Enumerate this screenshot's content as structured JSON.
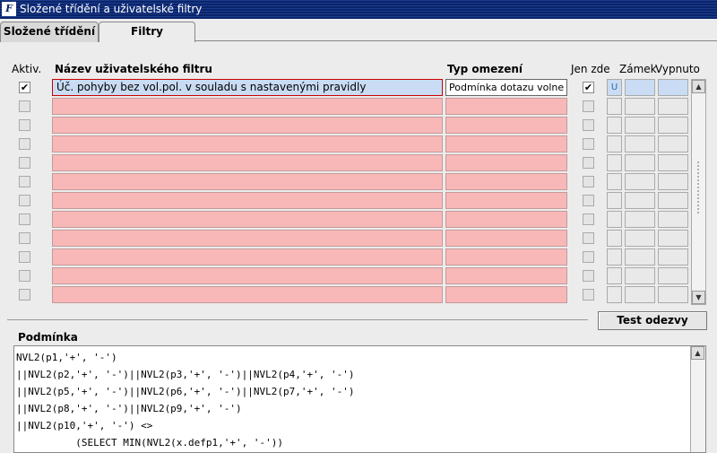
{
  "window": {
    "title": "Složené třídění a uživatelské filtry",
    "icon": "forms-icon"
  },
  "tabs": [
    {
      "label": "Složené třídění"
    },
    {
      "label": "Filtry"
    }
  ],
  "columns": {
    "aktiv": "Aktiv.",
    "name": "Název uživatelského filtru",
    "typ": "Typ omezení",
    "jen_zde": "Jen zde",
    "zamek": "Zámek",
    "vypnuto": "Vypnuto"
  },
  "rows": [
    {
      "aktiv": "✔",
      "name": "Úč. pohyby bez vol.pol. v souladu s nastavenými pravidly",
      "typ": "Podmínka dotazu volne",
      "jen_zde": "✔",
      "zamek": "U"
    },
    {
      "aktiv": "",
      "name": "",
      "typ": "",
      "jen_zde": "",
      "zamek": ""
    },
    {
      "aktiv": "",
      "name": "",
      "typ": "",
      "jen_zde": "",
      "zamek": ""
    },
    {
      "aktiv": "",
      "name": "",
      "typ": "",
      "jen_zde": "",
      "zamek": ""
    },
    {
      "aktiv": "",
      "name": "",
      "typ": "",
      "jen_zde": "",
      "zamek": ""
    },
    {
      "aktiv": "",
      "name": "",
      "typ": "",
      "jen_zde": "",
      "zamek": ""
    },
    {
      "aktiv": "",
      "name": "",
      "typ": "",
      "jen_zde": "",
      "zamek": ""
    },
    {
      "aktiv": "",
      "name": "",
      "typ": "",
      "jen_zde": "",
      "zamek": ""
    },
    {
      "aktiv": "",
      "name": "",
      "typ": "",
      "jen_zde": "",
      "zamek": ""
    },
    {
      "aktiv": "",
      "name": "",
      "typ": "",
      "jen_zde": "",
      "zamek": ""
    },
    {
      "aktiv": "",
      "name": "",
      "typ": "",
      "jen_zde": "",
      "zamek": ""
    },
    {
      "aktiv": "",
      "name": "",
      "typ": "",
      "jen_zde": "",
      "zamek": ""
    }
  ],
  "buttons": {
    "test": "Test odezvy"
  },
  "podminka": {
    "label": "Podmínka",
    "text": "NVL2(p1,'+', '-')\n||NVL2(p2,'+', '-')||NVL2(p3,'+', '-')||NVL2(p4,'+', '-')\n||NVL2(p5,'+', '-')||NVL2(p6,'+', '-')||NVL2(p7,'+', '-')\n||NVL2(p8,'+', '-')||NVL2(p9,'+', '-')\n||NVL2(p10,'+', '-') <>\n          (SELECT MIN(NVL2(x.defp1,'+', '-'))"
  },
  "colors": {
    "titlebar": "#0a246a",
    "required_field": "#f9b8b8",
    "active_field": "#c9dcf4"
  }
}
